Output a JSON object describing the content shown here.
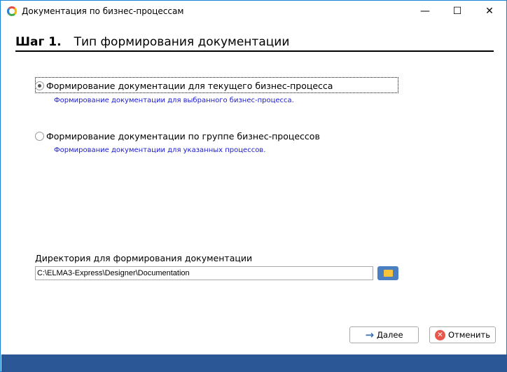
{
  "window": {
    "title": "Документация по бизнес-процессам",
    "controls": {
      "minimize": "—",
      "maximize": "☐",
      "close": "✕"
    }
  },
  "heading": {
    "step": "Шаг 1.",
    "title": "Тип формирования документации"
  },
  "options": [
    {
      "label": "Формирование документации для текущего бизнес-процесса",
      "description": "Формирование документации для выбранного бизнес-процесса.",
      "selected": true
    },
    {
      "label": "Формирование документации по группе бизнес-процессов",
      "description": "Формирование документации для указанных процессов.",
      "selected": false
    }
  ],
  "directory": {
    "label": "Директория для формирования документации",
    "value": "C:\\ELMA3-Express\\Designer\\Documentation"
  },
  "buttons": {
    "next": "Далее",
    "cancel": "Отменить"
  },
  "icons": {
    "next": "→",
    "cancel": "✕"
  }
}
